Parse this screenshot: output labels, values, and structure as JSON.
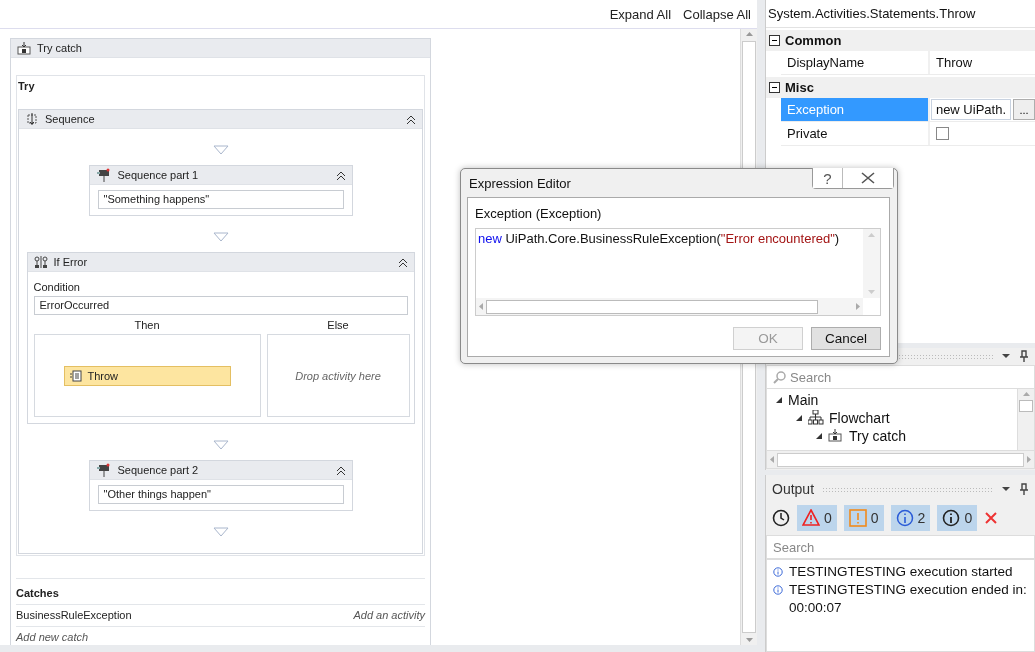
{
  "toolbar": {
    "buttons": [
      "Expand All",
      "Collapse All"
    ]
  },
  "designer": {
    "try_catch": {
      "title": "Try catch",
      "try_label": "Try",
      "sequence": {
        "title": "Sequence",
        "items": [
          {
            "kind": "activity",
            "title": "Sequence part 1",
            "value": "\"Something happens\""
          },
          {
            "kind": "if",
            "title": "If Error",
            "condition_label": "Condition",
            "condition": "ErrorOccurred",
            "then_label": "Then",
            "else_label": "Else",
            "then_activity": {
              "title": "Throw",
              "selected": true
            },
            "else_placeholder": "Drop activity here"
          },
          {
            "kind": "activity",
            "title": "Sequence part 2",
            "value": "\"Other things happen\""
          }
        ]
      },
      "catches_label": "Catches",
      "catches": [
        {
          "exception": "BusinessRuleException",
          "action": "Add an activity"
        }
      ],
      "add_catch": "Add new catch"
    }
  },
  "properties": {
    "title": "System.Activities.Statements.Throw",
    "categories": [
      {
        "name": "Common",
        "expanded": true,
        "rows": [
          {
            "kind": "text",
            "name": "DisplayName",
            "value": "Throw",
            "selected": false
          }
        ]
      },
      {
        "name": "Misc",
        "expanded": true,
        "rows": [
          {
            "kind": "expression",
            "name": "Exception",
            "value": "new UiPath.",
            "button": "...",
            "selected": true
          },
          {
            "kind": "checkbox",
            "name": "Private",
            "checked": false,
            "selected": false
          }
        ]
      }
    ]
  },
  "outline": {
    "search": {
      "placeholder": "Search"
    },
    "tree": [
      {
        "label": "Main",
        "expanded": true,
        "children": [
          {
            "kind": "flowchart",
            "label": "Flowchart",
            "expanded": true,
            "children": [
              {
                "kind": "try_catch",
                "label": "Try catch",
                "expanded": true
              }
            ]
          }
        ]
      }
    ]
  },
  "output": {
    "title": "Output",
    "filters": [
      {
        "kind": "error",
        "count": "0",
        "selected": true
      },
      {
        "kind": "warning",
        "count": "0",
        "selected": true
      },
      {
        "kind": "info",
        "count": "2",
        "selected": true
      },
      {
        "kind": "trace",
        "count": "0",
        "selected": true
      }
    ],
    "search": {
      "placeholder": "Search"
    },
    "messages": [
      {
        "kind": "info",
        "text": "TESTINGTESTING execution started"
      },
      {
        "kind": "info",
        "text": "TESTINGTESTING execution ended in: 00:00:07"
      }
    ]
  },
  "dialog": {
    "title": "Expression Editor",
    "help": "?",
    "label": "Exception (Exception)",
    "expression": [
      {
        "kind": "keyword",
        "text": "new"
      },
      {
        "kind": "plain",
        "text": " UiPath.Core.BusinessRuleException("
      },
      {
        "kind": "string",
        "text": "\"Error encountered\""
      },
      {
        "kind": "plain",
        "text": ")"
      }
    ],
    "buttons": [
      {
        "label": "OK",
        "disabled": true
      },
      {
        "label": "Cancel",
        "disabled": false
      }
    ]
  }
}
